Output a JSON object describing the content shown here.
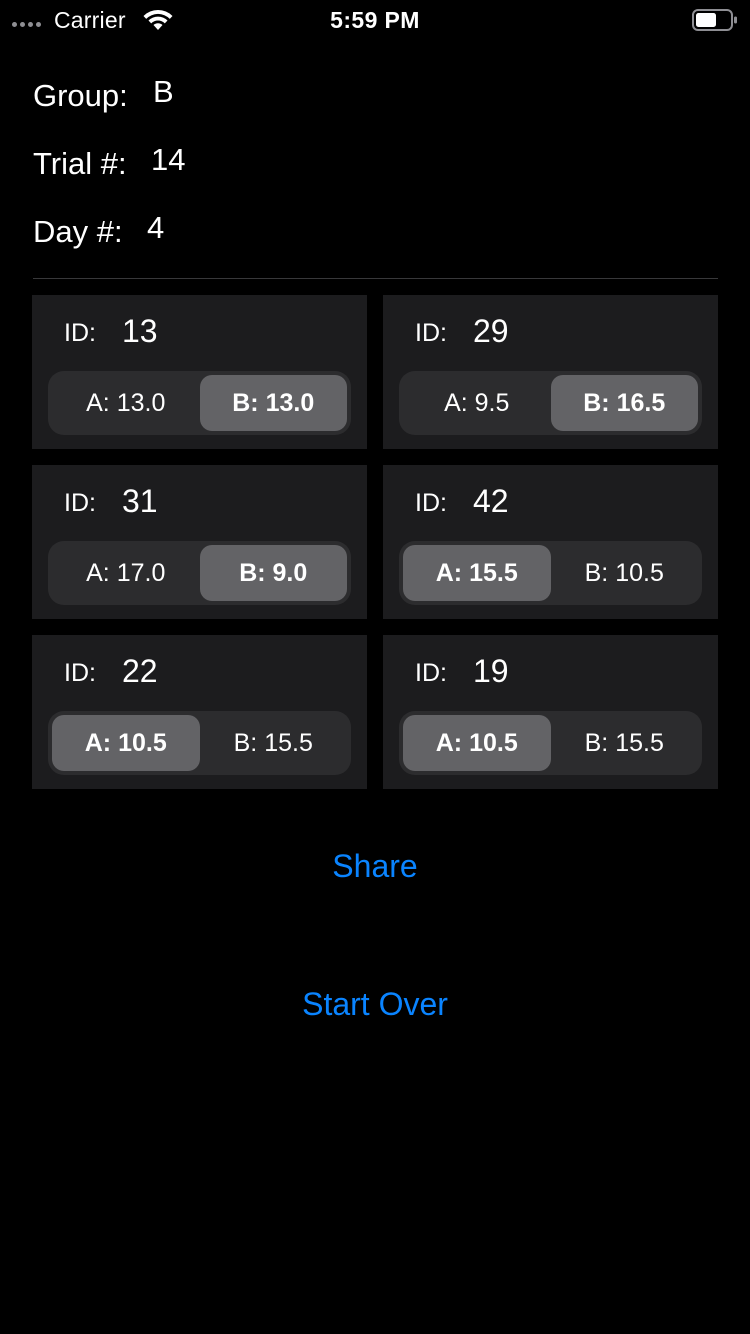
{
  "status_bar": {
    "carrier": "Carrier",
    "time": "5:59 PM",
    "icons": [
      "signal-dots-icon",
      "wifi-icon",
      "battery-icon"
    ]
  },
  "info": {
    "group_label": "Group:",
    "group_value": "B",
    "trial_label": "Trial #:",
    "trial_value": "14",
    "day_label": "Day #:",
    "day_value": "4"
  },
  "cards": [
    {
      "id_label": "ID:",
      "id": "13",
      "option_a": "A: 13.0",
      "option_b": "B: 13.0",
      "selected": "B"
    },
    {
      "id_label": "ID:",
      "id": "29",
      "option_a": "A: 9.5",
      "option_b": "B: 16.5",
      "selected": "B"
    },
    {
      "id_label": "ID:",
      "id": "31",
      "option_a": "A: 17.0",
      "option_b": "B: 9.0",
      "selected": "B"
    },
    {
      "id_label": "ID:",
      "id": "42",
      "option_a": "A: 15.5",
      "option_b": "B: 10.5",
      "selected": "A"
    },
    {
      "id_label": "ID:",
      "id": "22",
      "option_a": "A: 10.5",
      "option_b": "B: 15.5",
      "selected": "A"
    },
    {
      "id_label": "ID:",
      "id": "19",
      "option_a": "A: 10.5",
      "option_b": "B: 15.5",
      "selected": "A"
    }
  ],
  "actions": {
    "share_label": "Share",
    "start_over_label": "Start Over"
  },
  "colors": {
    "background": "#000000",
    "card": "#1c1c1e",
    "segment_track": "#2c2c2e",
    "segment_selected": "#636366",
    "accent": "#0a84ff"
  }
}
